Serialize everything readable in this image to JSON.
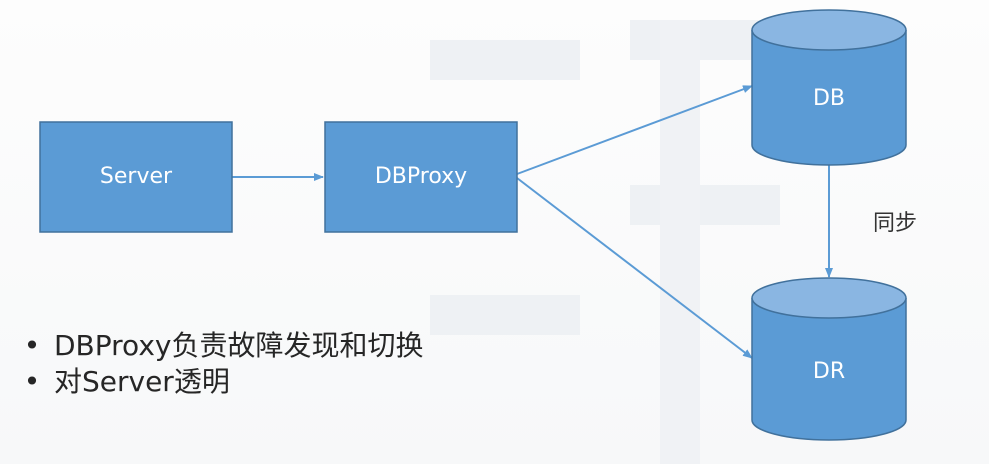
{
  "diagram": {
    "nodes": {
      "server": "Server",
      "dbproxy": "DBProxy",
      "db": "DB",
      "dr": "DR"
    },
    "edges": [
      {
        "from": "server",
        "to": "dbproxy"
      },
      {
        "from": "dbproxy",
        "to": "db"
      },
      {
        "from": "dbproxy",
        "to": "dr"
      },
      {
        "from": "db",
        "to": "dr",
        "label": "同步"
      }
    ],
    "sync_label": "同步"
  },
  "bullets": [
    "DBProxy负责故障发现和切换",
    "对Server透明"
  ],
  "bullet_glyph": "•",
  "colors": {
    "box_fill": "#5b9bd5",
    "box_stroke": "#41719c",
    "arrow": "#5b9bd5",
    "text_dark": "#262626"
  }
}
